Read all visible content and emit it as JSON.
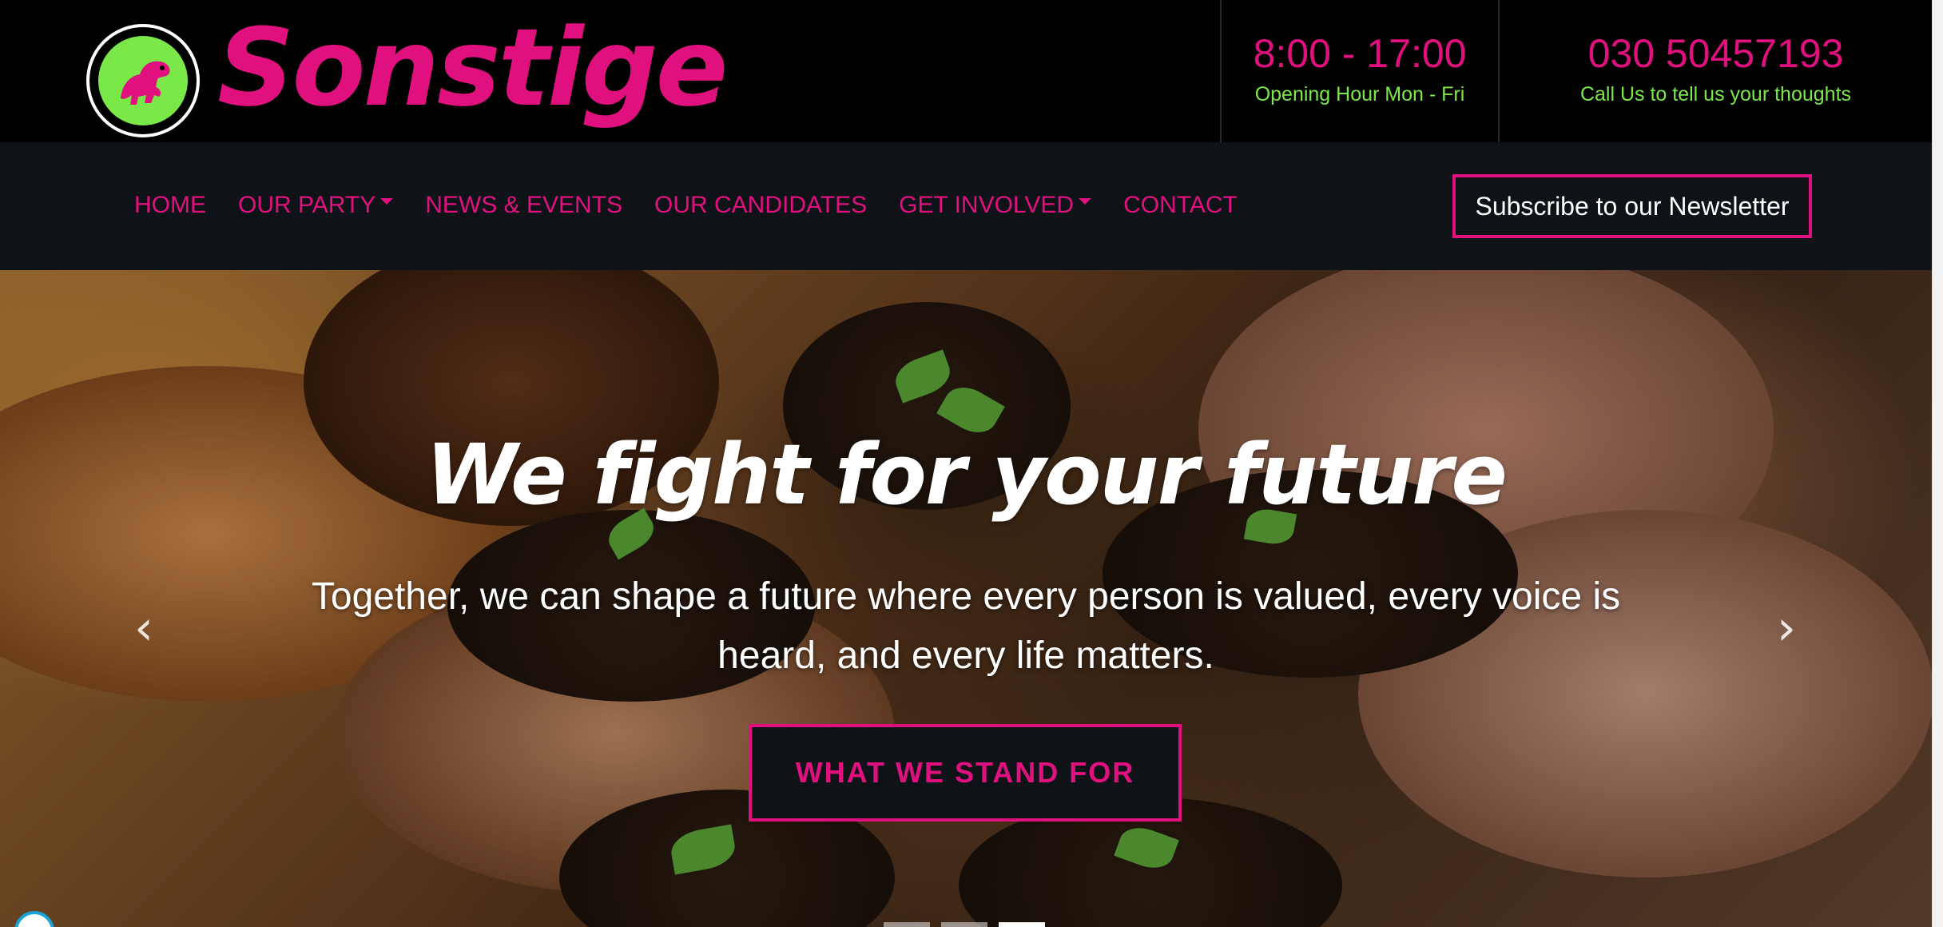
{
  "header": {
    "brand": "Sonstige",
    "hours": {
      "value": "8:00 - 17:00",
      "caption": "Opening Hour Mon - Fri"
    },
    "phone": {
      "value": "030 50457193",
      "caption": "Call Us to tell us your thoughts"
    }
  },
  "nav": {
    "items": [
      {
        "label": "HOME",
        "dropdown": false
      },
      {
        "label": "OUR PARTY",
        "dropdown": true
      },
      {
        "label": "NEWS & EVENTS",
        "dropdown": false
      },
      {
        "label": "OUR CANDIDATES",
        "dropdown": false
      },
      {
        "label": "GET INVOLVED",
        "dropdown": true
      },
      {
        "label": "CONTACT",
        "dropdown": false
      }
    ],
    "subscribe_label": "Subscribe to our Newsletter"
  },
  "hero": {
    "title": "We fight for your future",
    "subtitle": "Together, we can shape a future where every person is valued, every voice is heard, and every life matters.",
    "cta_label": "WHAT WE STAND FOR",
    "prev_icon": "chevron-left-icon",
    "next_icon": "chevron-right-icon",
    "slides_total": 3,
    "active_slide": 3
  },
  "colors": {
    "accent": "#e0117f",
    "secondary": "#7be84a",
    "nav_bg": "#0f1317",
    "header_bg": "#000000"
  }
}
